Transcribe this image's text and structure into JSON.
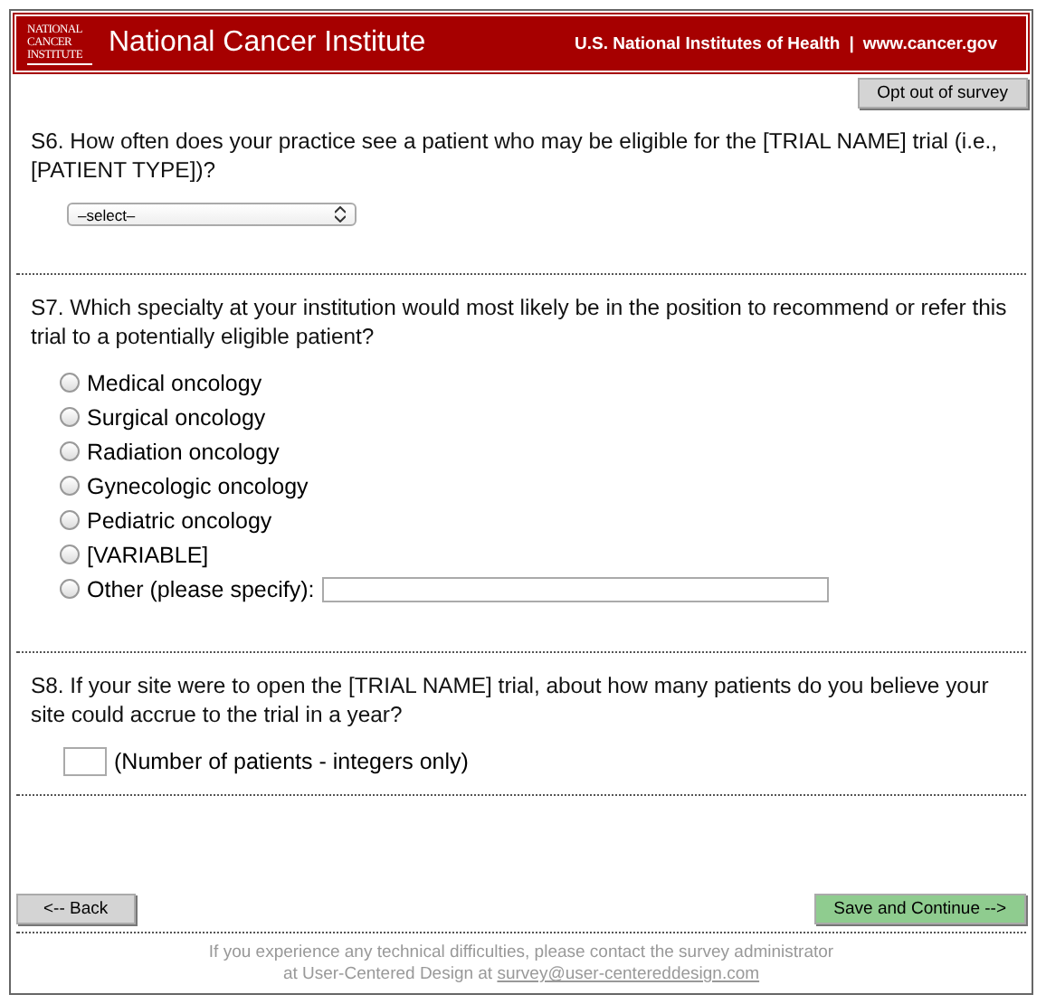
{
  "header": {
    "logo_lines": [
      "NATIONAL",
      "CANCER",
      "INSTITUTE"
    ],
    "title": "National Cancer Institute",
    "links": [
      "U.S. National Institutes of Health",
      "|",
      "www.cancer.gov"
    ]
  },
  "opt_out_button": "Opt out of survey",
  "questions": [
    {
      "kind": "select",
      "text": "S6. How often does your practice see a patient who may be eligible for the [TRIAL NAME] trial (i.e., [PATIENT TYPE])?",
      "value": "–select–"
    },
    {
      "kind": "radio",
      "text": "S7. Which specialty at your institution would most likely be in the position to recommend or refer this trial to a potentially eligible patient?",
      "options": [
        {
          "label": "Medical oncology",
          "selected": false
        },
        {
          "label": "Surgical oncology",
          "selected": false
        },
        {
          "label": "Radiation oncology",
          "selected": false
        },
        {
          "label": "Gynecologic oncology",
          "selected": false
        },
        {
          "label": "Pediatric oncology",
          "selected": false
        },
        {
          "label": "[VARIABLE]",
          "selected": false
        },
        {
          "label": "Other (please specify):",
          "selected": false,
          "has_field": true
        }
      ]
    },
    {
      "kind": "number",
      "text": "S8. If your site were to open the [TRIAL NAME] trial, about how many patients do you believe your site could accrue to the trial in a year?",
      "hint": "(Number of patients - integers only)"
    }
  ],
  "back_button": "<-- Back",
  "continue_button": "Save and Continue -->",
  "footer": {
    "line1": "If you experience any technical difficulties, please contact the survey administrator",
    "line2": "at User-Centered Design at",
    "email": "survey@user-centereddesign.com"
  }
}
